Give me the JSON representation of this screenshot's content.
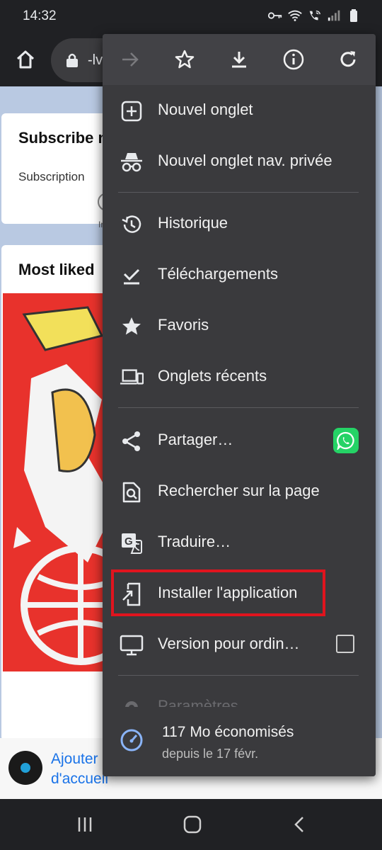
{
  "status_bar": {
    "time": "14:32"
  },
  "browser": {
    "url_partial": "-lv"
  },
  "page": {
    "card1_title": "Subscribe n",
    "card1_label": "Subscription",
    "card1_small": "Ir",
    "card2_title": "Most liked"
  },
  "menu": {
    "items": [
      {
        "label": "Nouvel onglet",
        "icon": "plus-box-icon"
      },
      {
        "label": "Nouvel onglet nav. privée",
        "icon": "incognito-icon"
      },
      {
        "label": "Historique",
        "icon": "history-icon"
      },
      {
        "label": "Téléchargements",
        "icon": "download-check-icon"
      },
      {
        "label": "Favoris",
        "icon": "star-icon"
      },
      {
        "label": "Onglets récents",
        "icon": "devices-icon"
      },
      {
        "label": "Partager…",
        "icon": "share-icon"
      },
      {
        "label": "Rechercher sur la page",
        "icon": "find-in-page-icon"
      },
      {
        "label": "Traduire…",
        "icon": "translate-icon"
      },
      {
        "label": "Installer l'application",
        "icon": "install-app-icon"
      },
      {
        "label": "Version pour ordin…",
        "icon": "desktop-icon"
      },
      {
        "label": "Paramètres",
        "icon": "gear-icon"
      }
    ],
    "savings_amount": "117 Mo économisés",
    "savings_since": "depuis le 17 févr."
  },
  "homebar": {
    "line1": "Ajouter",
    "line2": "d'accueil"
  },
  "colors": {
    "menu_bg": "#3a3a3d",
    "highlight": "#e0141e",
    "link": "#1a73e8"
  }
}
